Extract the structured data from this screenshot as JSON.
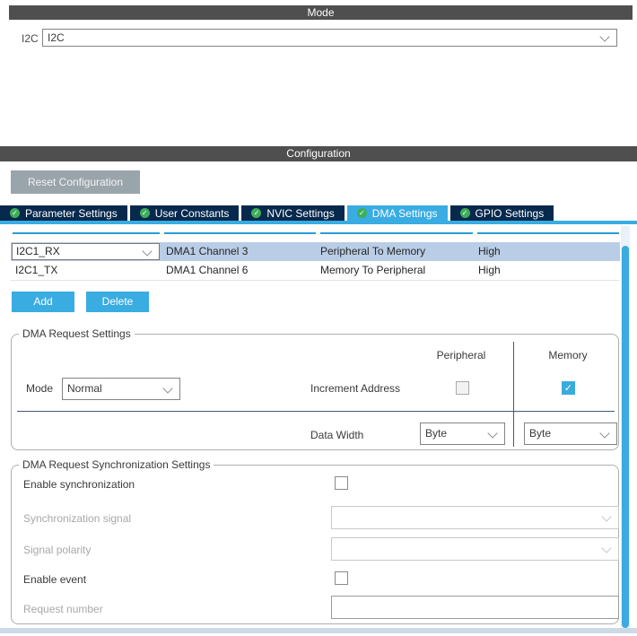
{
  "mode_panel": {
    "title": "Mode",
    "label": "I2C",
    "value": "I2C"
  },
  "configuration": {
    "title": "Configuration",
    "reset_button": "Reset Configuration",
    "tabs": [
      {
        "label": "Parameter Settings",
        "active": false
      },
      {
        "label": "User Constants",
        "active": false
      },
      {
        "label": "NVIC Settings",
        "active": false
      },
      {
        "label": "DMA Settings",
        "active": true
      },
      {
        "label": "GPIO Settings",
        "active": false
      }
    ],
    "dma_table": {
      "rows": [
        {
          "request": "I2C1_RX",
          "channel": "DMA1 Channel 3",
          "direction": "Peripheral To Memory",
          "priority": "High",
          "selected": true
        },
        {
          "request": "I2C1_TX",
          "channel": "DMA1 Channel 6",
          "direction": "Memory To Peripheral",
          "priority": "High",
          "selected": false
        }
      ]
    },
    "buttons": {
      "add": "Add",
      "delete": "Delete"
    },
    "request_settings": {
      "legend": "DMA Request Settings",
      "peripheral_header": "Peripheral",
      "memory_header": "Memory",
      "mode_label": "Mode",
      "mode_value": "Normal",
      "increment_address_label": "Increment Address",
      "peripheral_increment_checked": false,
      "memory_increment_checked": true,
      "data_width_label": "Data Width",
      "peripheral_data_width": "Byte",
      "memory_data_width": "Byte"
    },
    "sync_settings": {
      "legend": "DMA Request Synchronization Settings",
      "enable_sync_label": "Enable synchronization",
      "enable_sync_checked": false,
      "sync_signal_label": "Synchronization signal",
      "sync_signal_value": "",
      "signal_polarity_label": "Signal polarity",
      "signal_polarity_value": "",
      "enable_event_label": "Enable event",
      "enable_event_checked": false,
      "request_number_label": "Request number",
      "request_number_value": ""
    }
  },
  "icons": {
    "tab_check": "check-circle-icon",
    "dropdown": "chevron-down-icon"
  },
  "colors": {
    "accent_blue": "#39ace2",
    "tab_navy": "#07294d",
    "header_gray": "#4f4f4f",
    "selected_row": "#b9cde6",
    "check_green": "#3fae5a",
    "divider_blue": "#44597d",
    "checked_checkbox": "#3aabdd"
  }
}
